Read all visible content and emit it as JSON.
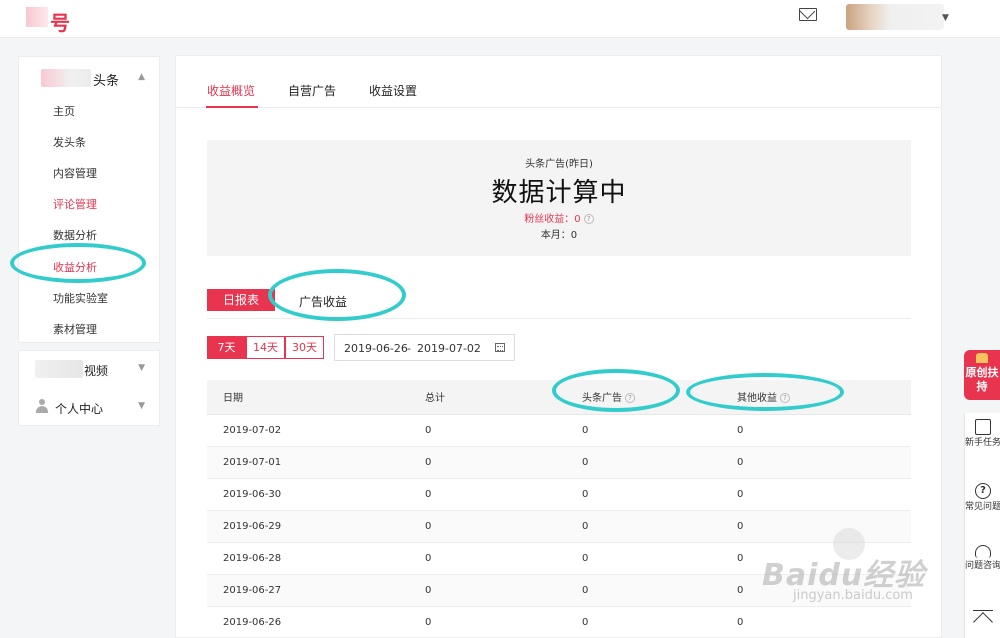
{
  "header": {
    "logo_suffix": "号",
    "mail_icon": "mail-icon"
  },
  "sidebar": {
    "section1": {
      "title_suffix": "头条",
      "items": [
        {
          "label": "主页",
          "active": false
        },
        {
          "label": "发头条",
          "active": false
        },
        {
          "label": "内容管理",
          "active": false
        },
        {
          "label": "评论管理",
          "active": true
        },
        {
          "label": "数据分析",
          "active": false
        },
        {
          "label": "收益分析",
          "active": true
        },
        {
          "label": "功能实验室",
          "active": false
        },
        {
          "label": "素材管理",
          "active": false
        }
      ]
    },
    "section2": {
      "title_suffix": "视频"
    },
    "section3": {
      "title": "个人中心"
    }
  },
  "tabs": [
    {
      "label": "收益概览",
      "active": true
    },
    {
      "label": "自营广告",
      "active": false
    },
    {
      "label": "收益设置",
      "active": false
    }
  ],
  "summary": {
    "label": "头条广告(昨日)",
    "big_text": "数据计算中",
    "fans_income": "粉丝收益：0",
    "this_month": "本月：0"
  },
  "subtabs": {
    "daily": "日报表",
    "ad_income": "广告收益"
  },
  "ranges": [
    "7天",
    "14天",
    "30天"
  ],
  "date_range": {
    "start": "2019-06-26",
    "separator": "-",
    "end": "2019-07-02"
  },
  "table": {
    "headers": [
      "日期",
      "总计",
      "头条广告",
      "其他收益"
    ],
    "rows": [
      [
        "2019-07-02",
        "0",
        "0",
        "0"
      ],
      [
        "2019-07-01",
        "0",
        "0",
        "0"
      ],
      [
        "2019-06-30",
        "0",
        "0",
        "0"
      ],
      [
        "2019-06-29",
        "0",
        "0",
        "0"
      ],
      [
        "2019-06-28",
        "0",
        "0",
        "0"
      ],
      [
        "2019-06-27",
        "0",
        "0",
        "0"
      ],
      [
        "2019-06-26",
        "0",
        "0",
        "0"
      ]
    ]
  },
  "right_widgets": {
    "badge": "原创扶持",
    "items": [
      {
        "label": "新手任务"
      },
      {
        "label": "常见问题"
      },
      {
        "label": "问题咨询"
      }
    ]
  },
  "watermark": {
    "main": "Baidu经验",
    "sub": "jingyan.baidu.com"
  },
  "colors": {
    "accent": "#e8344e",
    "annotation": "#33cccc",
    "panel_bg": "#f4f4f4"
  }
}
